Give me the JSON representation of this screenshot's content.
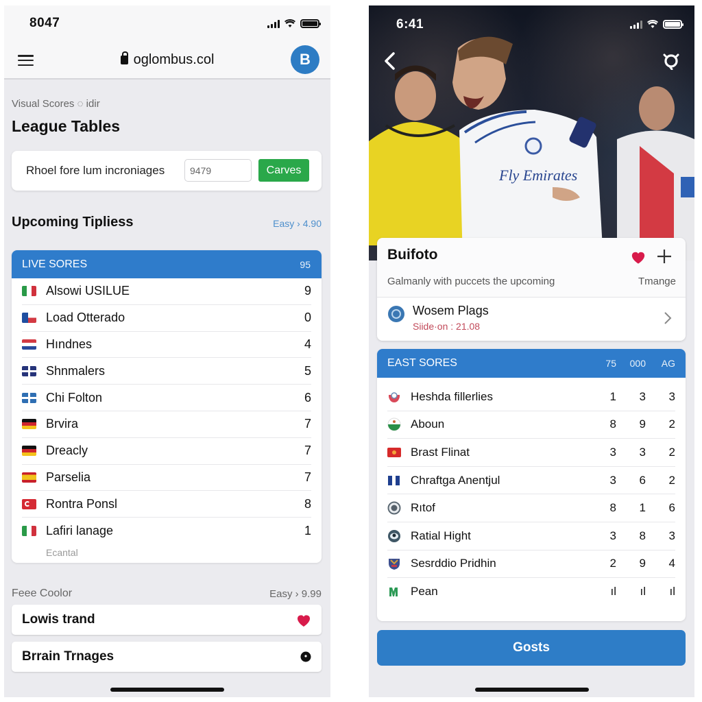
{
  "left_phone": {
    "status_bar": {
      "time": "8047"
    },
    "browser": {
      "url": "oglombus.col",
      "avatar_letter": "B"
    },
    "eyebrow": "Visual Scores ◌ idir",
    "page_title": "League Tables",
    "quick_card": {
      "label": "Rhoel fore lum incroniages",
      "input_value": "9479",
      "button_label": "Carves"
    },
    "upcoming": {
      "title": "Upcoming Tipliess",
      "meta": "Easy › 4.90"
    },
    "live_scores": {
      "header": "LIVE SORES",
      "header_value": "95",
      "rows": [
        {
          "flag": "italy",
          "name": "Alsowi USILUE",
          "value": "9"
        },
        {
          "flag": "czech",
          "name": "Load Otterado",
          "value": "0"
        },
        {
          "flag": "netherlands",
          "name": "Hındnes",
          "value": "4"
        },
        {
          "flag": "grid-navy",
          "name": "Shnmalers",
          "value": "5"
        },
        {
          "flag": "grid-blue",
          "name": "Chi Folton",
          "value": "6"
        },
        {
          "flag": "germany",
          "name": "Brvira",
          "value": "7"
        },
        {
          "flag": "germany",
          "name": "Dreacly",
          "value": "7"
        },
        {
          "flag": "spain",
          "name": "Parselia",
          "value": "7"
        },
        {
          "flag": "turkey",
          "name": "Rontra Ponsl",
          "value": "8"
        },
        {
          "flag": "italy",
          "name": "Lafiri lanage",
          "value": "1"
        }
      ],
      "footnote": "Ecantal"
    },
    "free": {
      "title": "Feee Coolor",
      "meta": "Easy › 9.99"
    },
    "list_items": [
      {
        "label": "Lowis trand",
        "icon": "heart-icon"
      },
      {
        "label": "Brrain Trnages",
        "icon": "dot-icon"
      }
    ]
  },
  "right_phone": {
    "status_bar": {
      "time": "6:41"
    },
    "hero": {
      "jersey_text": "Fly Emirates"
    },
    "info_card": {
      "title": "Buifoto",
      "description": "Galmanly with puccets the upcoming",
      "description_right": "Tmange",
      "sub_item": {
        "title": "Wosem Plags",
        "meta": "Siide·on : 21.08"
      }
    },
    "east_scores": {
      "header": "EAST SORES",
      "columns": [
        "75",
        "000",
        "AG"
      ],
      "rows": [
        {
          "crest": "crest-red",
          "name": "Heshda fillerlies",
          "values": [
            "1",
            "3",
            "3"
          ]
        },
        {
          "crest": "crest-green",
          "name": "Aboun",
          "values": [
            "8",
            "9",
            "2"
          ]
        },
        {
          "crest": "crest-flag-red",
          "name": "Brast Flinat",
          "values": [
            "3",
            "3",
            "2"
          ]
        },
        {
          "crest": "crest-bars-blue",
          "name": "Chraftga Anentjul",
          "values": [
            "3",
            "6",
            "2"
          ]
        },
        {
          "crest": "crest-grey",
          "name": "Rıtof",
          "values": [
            "8",
            "1",
            "6"
          ]
        },
        {
          "crest": "crest-eye",
          "name": "Ratial Hight",
          "values": [
            "3",
            "8",
            "3"
          ]
        },
        {
          "crest": "crest-shield",
          "name": "Sesrddio Pridhin",
          "values": [
            "2",
            "9",
            "4"
          ]
        },
        {
          "crest": "crest-green-m",
          "name": "Pean",
          "values": [
            "ıl",
            "ıl",
            "ıl"
          ]
        }
      ]
    },
    "primary_button": "Gosts"
  },
  "colors": {
    "accent_blue": "#2f7ccb",
    "green_button": "#2aa84a",
    "heart_red": "#d81b4b",
    "meta_blue": "#4d8fcc"
  }
}
